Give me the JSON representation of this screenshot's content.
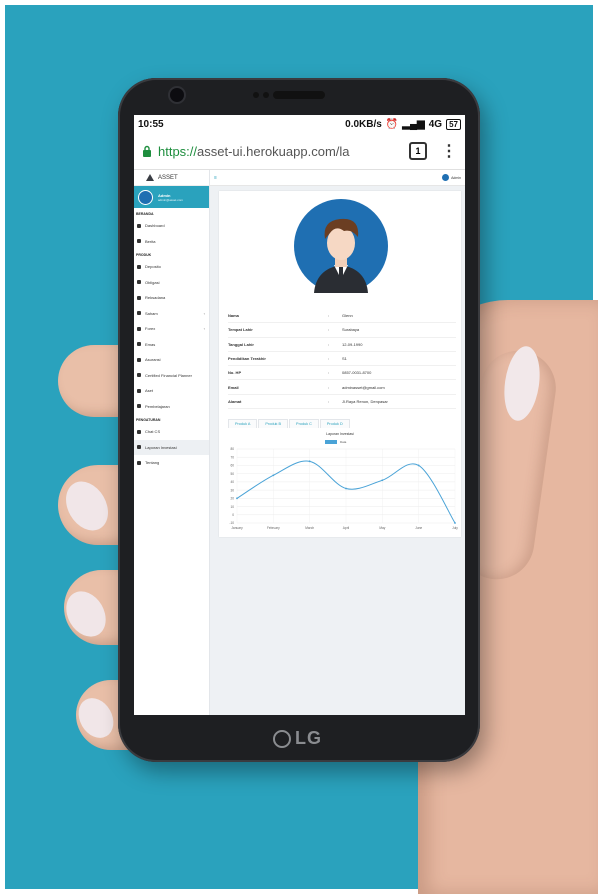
{
  "phone": {
    "brand": "LG"
  },
  "status_bar": {
    "time": "10:55",
    "net_speed": "0.0KB/s",
    "network": "4G",
    "battery": "57"
  },
  "browser": {
    "url_scheme": "https://",
    "url_rest": "asset-ui.herokuapp.com/la",
    "tab_count": "1"
  },
  "app": {
    "brand": "ASSET",
    "user": {
      "name": "Admin",
      "email": "admin@asset.com",
      "topbar_name": "Admin"
    },
    "sidebar": {
      "sections": [
        {
          "title": "BERANDA",
          "items": [
            {
              "label": "Dashboard"
            },
            {
              "label": "Berita"
            }
          ]
        },
        {
          "title": "PRODUK",
          "items": [
            {
              "label": "Deposito"
            },
            {
              "label": "Obligasi"
            },
            {
              "label": "Reksadana"
            },
            {
              "label": "Saham",
              "chevron": true
            },
            {
              "label": "Forex",
              "chevron": true
            },
            {
              "label": "Emas"
            },
            {
              "label": "Asuransi"
            },
            {
              "label": "Certified Financial Planner"
            },
            {
              "label": "Aset"
            },
            {
              "label": "Pembelajaran"
            }
          ]
        },
        {
          "title": "PENGATURAN",
          "items": [
            {
              "label": "Chat CS"
            },
            {
              "label": "Laporan Investasi",
              "active": true
            },
            {
              "label": "Tentang"
            }
          ]
        }
      ]
    },
    "profile": {
      "rows": [
        {
          "key": "Nama",
          "value": "Glenn"
        },
        {
          "key": "Tempat Lahir",
          "value": "Surabaya"
        },
        {
          "key": "Tanggal Lahir",
          "value": "12-09-1990"
        },
        {
          "key": "Pendidikan Terakhir",
          "value": "S1"
        },
        {
          "key": "No. HP",
          "value": "0857-0031-8700"
        },
        {
          "key": "Email",
          "value": "adminasset@gmail.com"
        },
        {
          "key": "Alamat",
          "value": "Jl.Raya Renon, Denpasar"
        }
      ],
      "separator": ":"
    },
    "product_tabs": [
      "Produk A",
      "Produk B",
      "Produk C",
      "Produk D"
    ]
  },
  "chart_data": {
    "type": "line",
    "title": "Laporan Investasi",
    "categories": [
      "January",
      "February",
      "March",
      "April",
      "May",
      "June",
      "July"
    ],
    "series": [
      {
        "name": "Data",
        "values": [
          20,
          48,
          65,
          32,
          42,
          60,
          -10
        ],
        "color": "#4aa3d7"
      }
    ],
    "ylim": [
      -10,
      80
    ],
    "yticks": [
      -10,
      0,
      10,
      20,
      30,
      40,
      50,
      60,
      70,
      80
    ],
    "grid": true,
    "legend": "top"
  }
}
